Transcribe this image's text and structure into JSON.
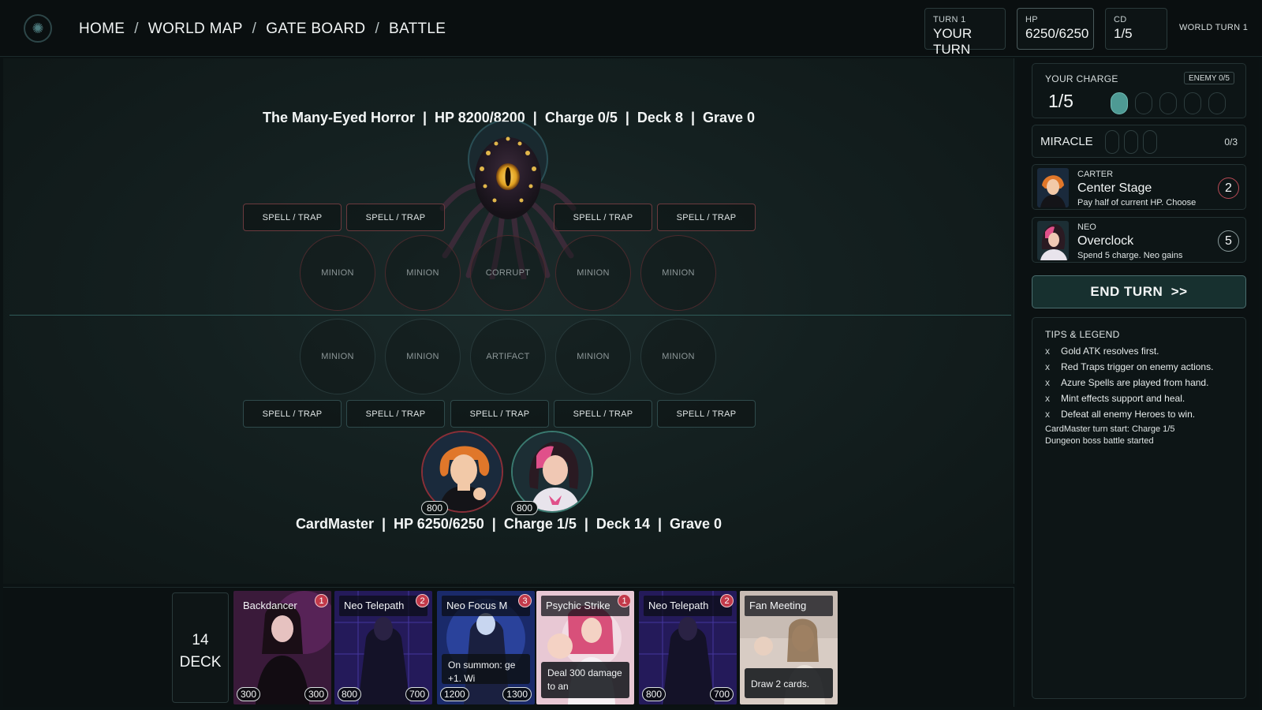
{
  "nav": {
    "breadcrumb": [
      "HOME",
      "WORLD MAP",
      "GATE BOARD",
      "BATTLE"
    ],
    "separator": "/"
  },
  "header": {
    "turn_label": "TURN 1",
    "turn_value": "YOUR TURN",
    "hp_label": "HP",
    "hp_value": "6250/6250",
    "cd_label": "CD",
    "cd_value": "1/5",
    "world_turn": "WORLD TURN 1"
  },
  "enemy": {
    "status_line": "The Many-Eyed Horror  |  HP 8200/8200  |  Charge 0/5  |  Deck 8  |  Grave 0",
    "spell_slots": [
      "SPELL / TRAP",
      "SPELL / TRAP",
      "SPELL / TRAP",
      "SPELL / TRAP"
    ],
    "minion_slots": [
      "MINION",
      "MINION",
      "CORRUPT",
      "MINION",
      "MINION"
    ]
  },
  "player": {
    "status_line": "CardMaster  |  HP 6250/6250  |  Charge 1/5  |  Deck 14  |  Grave 0",
    "minion_slots": [
      "MINION",
      "MINION",
      "ARTIFACT",
      "MINION",
      "MINION"
    ],
    "spell_slots": [
      "SPELL / TRAP",
      "SPELL / TRAP",
      "SPELL / TRAP",
      "SPELL / TRAP",
      "SPELL / TRAP"
    ],
    "heroes": [
      {
        "name": "carter",
        "hp": "800"
      },
      {
        "name": "neo",
        "hp": "800"
      }
    ]
  },
  "hand": {
    "deck_count": "14",
    "deck_label": "DECK",
    "cards": [
      {
        "name": "Backdancer",
        "cost": "1",
        "atk": "300",
        "def": "300",
        "desc": ""
      },
      {
        "name": "Neo Telepath",
        "cost": "2",
        "atk": "800",
        "def": "700",
        "desc": ""
      },
      {
        "name": "Neo Focus M",
        "cost": "3",
        "atk": "1200",
        "def": "1300",
        "desc": "On summon: ge +1. Wi"
      },
      {
        "name": "Psychic Strike",
        "cost": "1",
        "atk": "",
        "def": "",
        "desc": "Deal 300 damage to an"
      },
      {
        "name": "Neo Telepath",
        "cost": "2",
        "atk": "800",
        "def": "700",
        "desc": ""
      },
      {
        "name": "Fan Meeting",
        "cost": "",
        "atk": "",
        "def": "",
        "desc": "Draw 2 cards."
      }
    ]
  },
  "panel": {
    "charge_label": "YOUR CHARGE",
    "charge_value": "1/5",
    "enemy_charge": "ENEMY 0/5",
    "charge_pips_filled": 1,
    "charge_pips_total": 5,
    "miracle_label": "MIRACLE",
    "miracle_count": "0/3",
    "abilities": [
      {
        "who": "CARTER",
        "title": "Center Stage",
        "text": "Pay half of current HP. Choose",
        "cost": "2"
      },
      {
        "who": "NEO",
        "title": "Overclock",
        "text": "Spend 5 charge. Neo gains",
        "cost": "5"
      }
    ],
    "end_turn": "END TURN  >>",
    "tips_title": "TIPS & LEGEND",
    "tips": [
      "Gold ATK resolves first.",
      "Red Traps trigger on enemy actions.",
      "Azure Spells are played from hand.",
      "Mint effects support and heal.",
      "Defeat all enemy Heroes to win."
    ],
    "tip_marker": "x",
    "log": [
      "CardMaster turn start: Charge 1/5",
      "Dungeon boss battle started"
    ]
  },
  "colors": {
    "accent_mint": "#4e9a94",
    "enemy_red": "#8a2f38",
    "panel_bg": "#0b1112"
  }
}
